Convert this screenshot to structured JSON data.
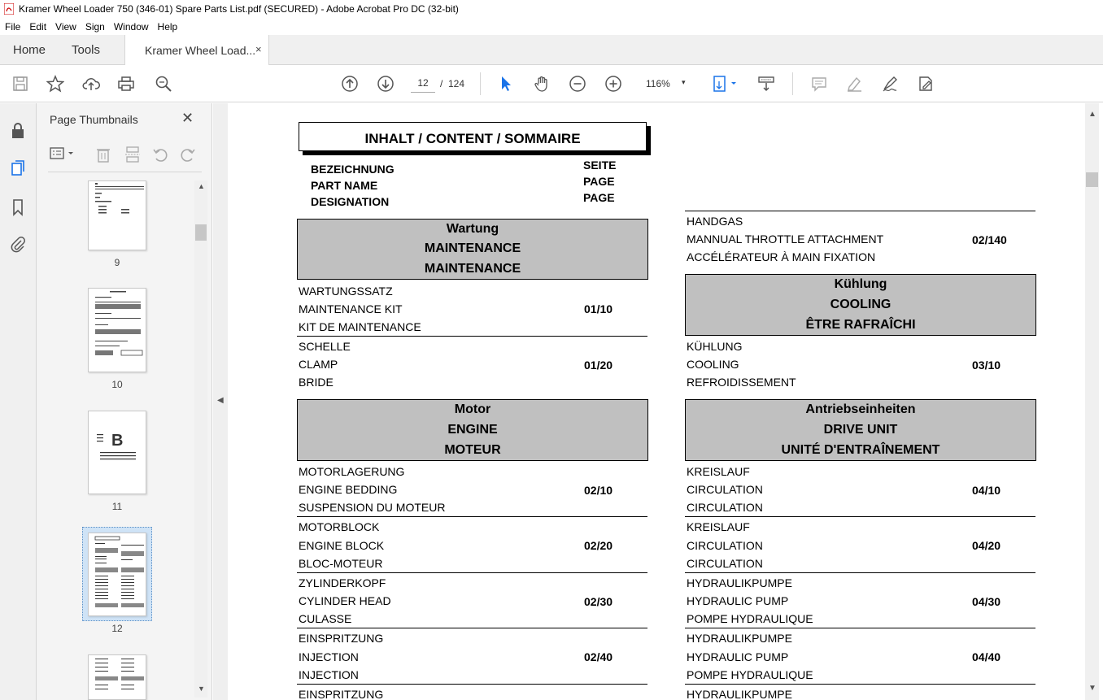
{
  "window": {
    "title": "Kramer Wheel Loader 750 (346-01) Spare Parts List.pdf (SECURED) - Adobe Acrobat Pro DC (32-bit)"
  },
  "menu": [
    "File",
    "Edit",
    "View",
    "Sign",
    "Window",
    "Help"
  ],
  "tabs": {
    "home": "Home",
    "tools": "Tools",
    "document": "Kramer Wheel Load...",
    "close": "×"
  },
  "toolbar": {
    "page_current": "12",
    "page_sep": "/",
    "page_total": "124",
    "zoom": "116%",
    "zoom_caret": "▾"
  },
  "thumbnails": {
    "title": "Page Thumbnails",
    "close": "✕",
    "pages": [
      "9",
      "10",
      "11",
      "12"
    ],
    "selected": "12"
  },
  "document": {
    "content_title": "INHALT / CONTENT / SOMMAIRE",
    "header_left": [
      "BEZEICHNUNG",
      "PART NAME",
      "DESIGNATION"
    ],
    "header_right": [
      "SEITE",
      "PAGE",
      "PAGE"
    ],
    "left_column": {
      "sections": [
        {
          "lines": [
            "Wartung",
            "MAINTENANCE",
            "MAINTENANCE"
          ]
        },
        {
          "lines": [
            "Motor",
            "ENGINE",
            "MOTEUR"
          ]
        }
      ],
      "items": [
        {
          "lines": [
            "WARTUNGSSATZ",
            "MAINTENANCE KIT",
            "KIT DE MAINTENANCE"
          ],
          "page": "01/10"
        },
        {
          "lines": [
            "SCHELLE",
            "CLAMP",
            "BRIDE"
          ],
          "page": "01/20"
        },
        {
          "lines": [
            "MOTORLAGERUNG",
            "ENGINE BEDDING",
            "SUSPENSION DU MOTEUR"
          ],
          "page": "02/10"
        },
        {
          "lines": [
            "MOTORBLOCK",
            "ENGINE BLOCK",
            "BLOC-MOTEUR"
          ],
          "page": "02/20"
        },
        {
          "lines": [
            "ZYLINDERKOPF",
            "CYLINDER HEAD",
            "CULASSE"
          ],
          "page": "02/30"
        },
        {
          "lines": [
            "EINSPRITZUNG",
            "INJECTION",
            "INJECTION"
          ],
          "page": "02/40"
        },
        {
          "lines": [
            "EINSPRITZUNG"
          ],
          "page": ""
        }
      ]
    },
    "right_column": {
      "sections": [
        {
          "lines": [
            "Kühlung",
            "COOLING",
            "ÊTRE RAFRAÎCHI"
          ]
        },
        {
          "lines": [
            "Antriebseinheiten",
            "DRIVE UNIT",
            "UNITÉ D'ENTRAÎNEMENT"
          ]
        }
      ],
      "items": [
        {
          "lines": [
            "HANDGAS",
            "MANNUAL THROTTLE ATTACHMENT",
            "ACCÉLÉRATEUR À MAIN FIXATION"
          ],
          "page": "02/140"
        },
        {
          "lines": [
            "KÜHLUNG",
            "COOLING",
            "REFROIDISSEMENT"
          ],
          "page": "03/10"
        },
        {
          "lines": [
            "KREISLAUF",
            "CIRCULATION",
            "CIRCULATION"
          ],
          "page": "04/10"
        },
        {
          "lines": [
            "KREISLAUF",
            "CIRCULATION",
            "CIRCULATION"
          ],
          "page": "04/20"
        },
        {
          "lines": [
            "HYDRAULIKPUMPE",
            "HYDRAULIC PUMP",
            "POMPE HYDRAULIQUE"
          ],
          "page": "04/30"
        },
        {
          "lines": [
            "HYDRAULIKPUMPE",
            "HYDRAULIC PUMP",
            "POMPE HYDRAULIQUE"
          ],
          "page": "04/40"
        },
        {
          "lines": [
            "HYDRAULIKPUMPE"
          ],
          "page": ""
        }
      ]
    }
  },
  "icons": {
    "save": "save-icon",
    "bookmark": "star-icon",
    "upload": "upload-icon",
    "print": "print-icon",
    "find": "search-zoom-icon",
    "prev": "arrow-up-icon",
    "next": "arrow-down-icon",
    "select": "cursor-icon",
    "hand": "hand-icon",
    "zoom_out": "zoom-out-icon",
    "zoom_in": "zoom-in-icon"
  }
}
